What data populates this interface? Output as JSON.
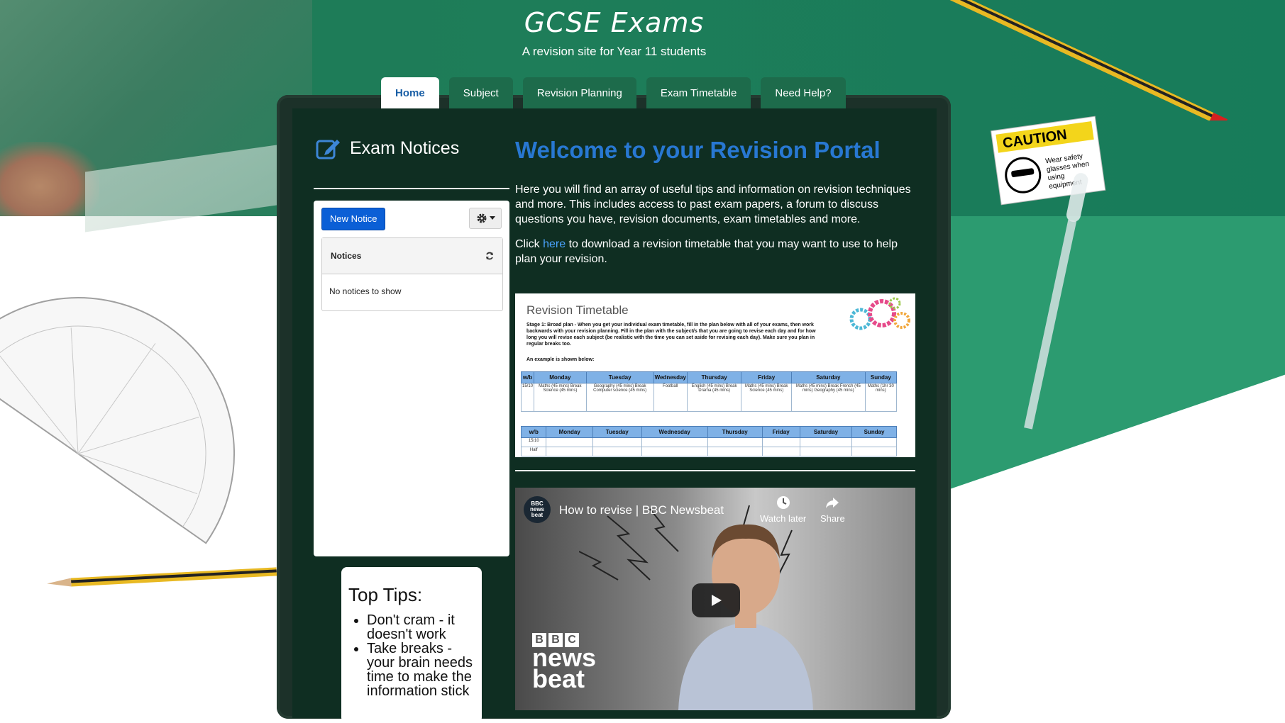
{
  "header": {
    "title": "GCSE Exams",
    "subtitle": "A revision site for Year 11 students"
  },
  "nav": {
    "tabs": [
      "Home",
      "Subject",
      "Revision Planning",
      "Exam Timetable",
      "Need Help?"
    ],
    "active": "Home"
  },
  "notices": {
    "heading": "Exam Notices",
    "new_button": "New Notice",
    "panel_title": "Notices",
    "empty_text": "No notices to show"
  },
  "tips": {
    "heading": "Top Tips:",
    "items": [
      "Don't cram - it doesn't work",
      "Take breaks - your brain needs time to make the information stick"
    ]
  },
  "welcome": {
    "heading": "Welcome to your Revision Portal",
    "para1": "Here you will find an array of useful tips and information on revision techniques and more. This includes access to past exam papers, a  forum to discuss questions you have, revision documents, exam timetables and more.",
    "para2_before": "Click ",
    "para2_link": "here",
    "para2_after": " to download a revision timetable that you may want to use to help plan your revision."
  },
  "timetable": {
    "title": "Revision Timetable",
    "text": "Stage 1: Broad plan - When you get your individual exam timetable, fill in the plan below with all of your exams, then work backwards with your revision planning. Fill in the plan with the subject/s that you are going to revise each day and for how long you will revise each subject (be realistic with the time you can set aside for revising each day). Make sure you plan in regular breaks too.",
    "example_label": "An example is shown below:",
    "headers": [
      "w/b",
      "Monday",
      "Tuesday",
      "Wednesday",
      "Thursday",
      "Friday",
      "Saturday",
      "Sunday"
    ],
    "example_row": [
      "15/10",
      "Maths (45 mins) Break Science (45 mins)",
      "Geography (45 mins) Break Computer science (45 mins)",
      "Football",
      "English (45 mins) Break Drama (45 mins)",
      "Maths (45 mins) Break Science (45 mins)",
      "Maths (45 mins) Break French (45 mins) Geography (45 mins)",
      "Maths (1hr 30 mins)"
    ],
    "blank_rows": [
      "15/10",
      "Half"
    ]
  },
  "video": {
    "channel": "BBC news beat",
    "title": "How to revise | BBC Newsbeat",
    "watch_later": "Watch later",
    "share": "Share",
    "brand_word1": "news",
    "brand_word2": "beat"
  },
  "decor": {
    "caution": "CAUTION",
    "caution_text": "Wear safety glasses when using equipment"
  },
  "colors": {
    "green": "#1e7d59",
    "board": "#0f2e22",
    "accent_blue": "#2878d2",
    "button_blue": "#0b5fd6"
  }
}
